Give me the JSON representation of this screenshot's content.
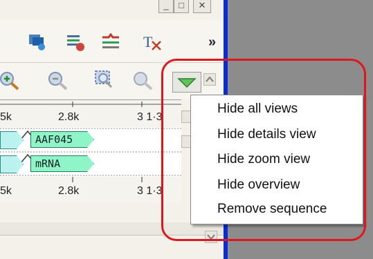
{
  "window": {
    "buttons": [
      "minimize-button",
      "maximize-button",
      "close-button"
    ],
    "close_label": "✕"
  },
  "toolbar": {
    "overflow_label": "»",
    "icons": [
      "annotate-icon",
      "list-settings-icon",
      "restriction-sites-icon",
      "text-tool-icon"
    ]
  },
  "zoom_toolbar": {
    "icons": [
      "zoom-in-icon",
      "zoom-out-icon",
      "zoom-to-selection-icon",
      "zoom-reset-icon"
    ],
    "dropdown_button": "triangle-down-icon"
  },
  "ruler": {
    "top_ticks": [
      "5k",
      "2.8k",
      "3 1·3"
    ],
    "bottom_ticks": [
      "5k",
      "2.8k",
      "3 1·3"
    ]
  },
  "tracks": [
    {
      "label": "AAF045"
    },
    {
      "label": "mRNA"
    }
  ],
  "context_menu": {
    "items": [
      "Hide all views",
      "Hide details view",
      "Hide zoom view",
      "Hide overview",
      "Remove sequence"
    ]
  },
  "colors": {
    "highlight": "#e0161d",
    "feature_fill": "#8ff5c8",
    "right_border": "#0a2bd8"
  }
}
